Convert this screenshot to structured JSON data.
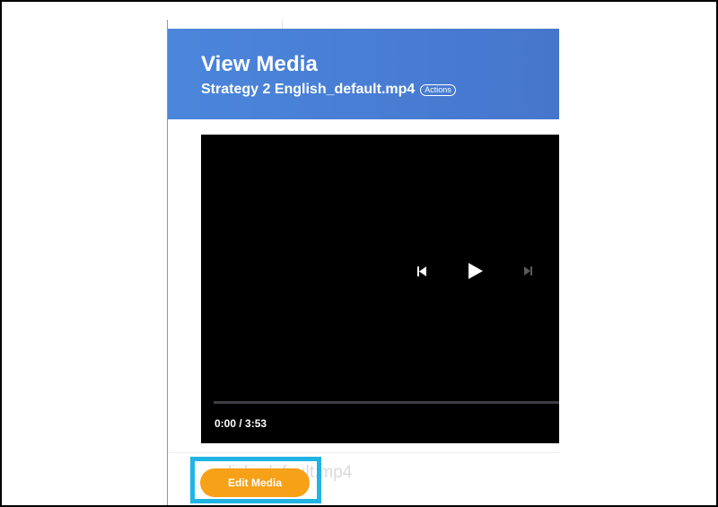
{
  "header": {
    "title": "View Media",
    "filename": "Strategy 2 English_default.mp4",
    "actions_label": "Actions"
  },
  "player": {
    "time_display": "0:00 / 3:53",
    "progress": 0
  },
  "background_filename": "lish_default.mp4",
  "edit_button": {
    "label": "Edit Media"
  },
  "colors": {
    "header_start": "#4b86db",
    "header_end": "#4576cc",
    "button": "#f6a118",
    "highlight": "#1fb4e4"
  },
  "icons": {
    "previous": "skip-previous-icon",
    "play": "play-icon",
    "next": "skip-next-icon"
  }
}
